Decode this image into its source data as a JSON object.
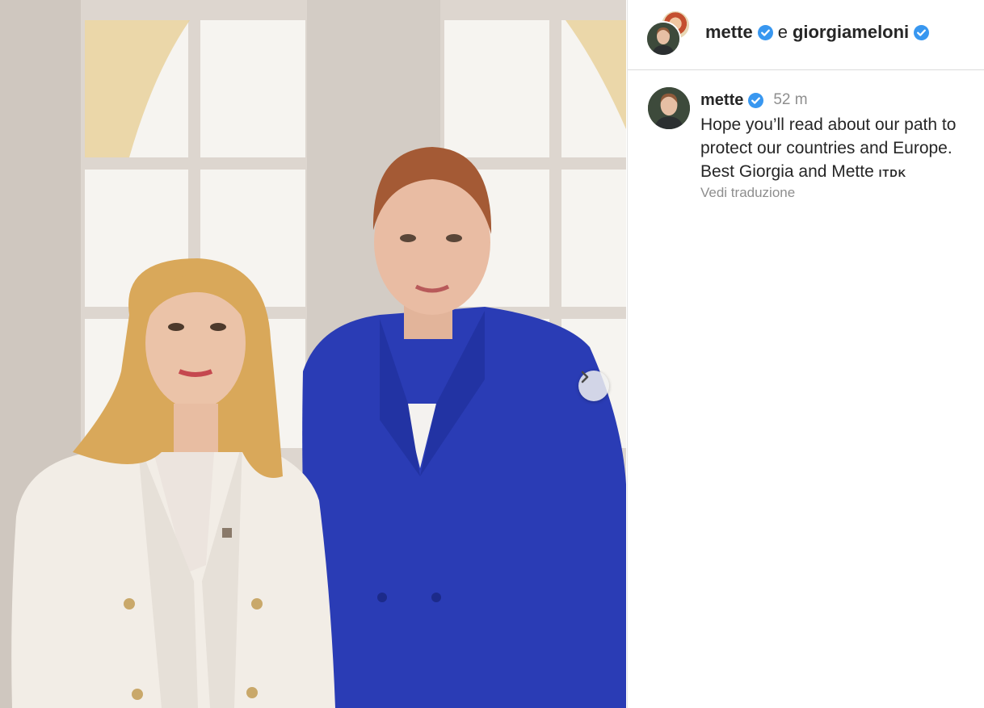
{
  "header": {
    "user1": "mette",
    "conjunction": "e",
    "user2": "giorgiameloni"
  },
  "comment": {
    "username": "mette",
    "time": "52 m",
    "text": "Hope you’ll read about our path to\nprotect our countries and Europe.\nBest Giorgia and Mette",
    "flags": "ITDK",
    "translate": "Vedi traduzione"
  },
  "colors": {
    "verified": "#3897f0",
    "text": "#262626",
    "muted": "#8e8e8e",
    "blazer_blue": "#2a3cb5",
    "blazer_white": "#f2ede6"
  },
  "icons": {
    "verified": "verified-badge-icon",
    "next": "chevron-right-icon"
  }
}
